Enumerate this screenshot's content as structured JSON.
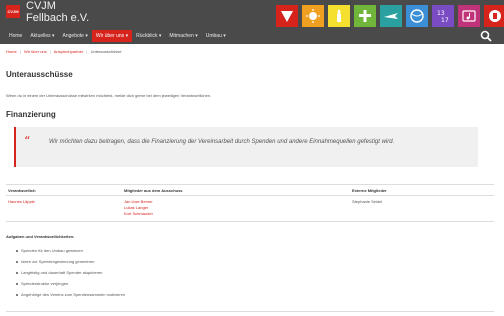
{
  "brand": {
    "logo_text": "CVJM",
    "name": "CVJM",
    "sub": "Fellbach e.V."
  },
  "header_icons": [
    {
      "name": "triangle-icon",
      "color": "#d6231c"
    },
    {
      "name": "sun-icon",
      "color": "#f0a020"
    },
    {
      "name": "candle-icon",
      "color": "#f5e030"
    },
    {
      "name": "cross-icon",
      "color": "#6fb63a"
    },
    {
      "name": "plane-icon",
      "color": "#2aa0a0"
    },
    {
      "name": "ball-icon",
      "color": "#3a8fd6"
    },
    {
      "name": "numbers-icon",
      "color": "#7a4cc4"
    },
    {
      "name": "music-icon",
      "color": "#c0327a"
    },
    {
      "name": "shield-icon",
      "color": "#d6231c"
    }
  ],
  "nav": {
    "items": [
      {
        "label": "Home",
        "active": false
      },
      {
        "label": "Aktuelles ▾",
        "active": false
      },
      {
        "label": "Angebote ▾",
        "active": false
      },
      {
        "label": "Wir über uns ▾",
        "active": true
      },
      {
        "label": "Rückblick ▾",
        "active": false
      },
      {
        "label": "Mitmachen ▾",
        "active": false
      },
      {
        "label": "Umbau ▾",
        "active": false
      }
    ]
  },
  "breadcrumb": {
    "home": "Home",
    "about": "Wir über uns",
    "contacts": "Ansprechpartner",
    "current": "Unterausschüsse",
    "separator": "|"
  },
  "page": {
    "title": "Unterausschüsse",
    "intro": "Wenn du in einem der Unterausschüsse mitwirken möchtest, melde dich gerne bei dem jeweiligen Verantwortlichen.",
    "section_title": "Finanzierung",
    "quote_mark": "“",
    "quote": "Wir möchten dazu beitragen, dass die Finanzierung der Vereinsarbeit durch Spenden und andere Einnahmequellen gefestigt wird."
  },
  "table": {
    "headers": [
      "Verantwortlich",
      "Mitglieder aus dem Ausschuss",
      "Externe Mitglieder"
    ],
    "responsible": "Hannes Läpple",
    "members": [
      "Jan Uwe Berner",
      "Lukas Langer",
      "Kurt Schmauder"
    ],
    "external": "Stephanie Seidel"
  },
  "tasks": {
    "title": "Aufgaben und Verantwortlichkeiten:",
    "items": [
      "Spenden für den Umbau gewinnen",
      "Ideen zur Spendengewinnung generieren",
      "Langfristig und dauerhaft Spender akquirieren",
      "Spenderstruktur verjüngen",
      "Angehörige des Vereins zum Spendensammeln motivieren"
    ]
  },
  "colors": {
    "accent": "#d6231c",
    "header_bg": "#4a4a4a",
    "quote_bg": "#f0f0f0"
  }
}
